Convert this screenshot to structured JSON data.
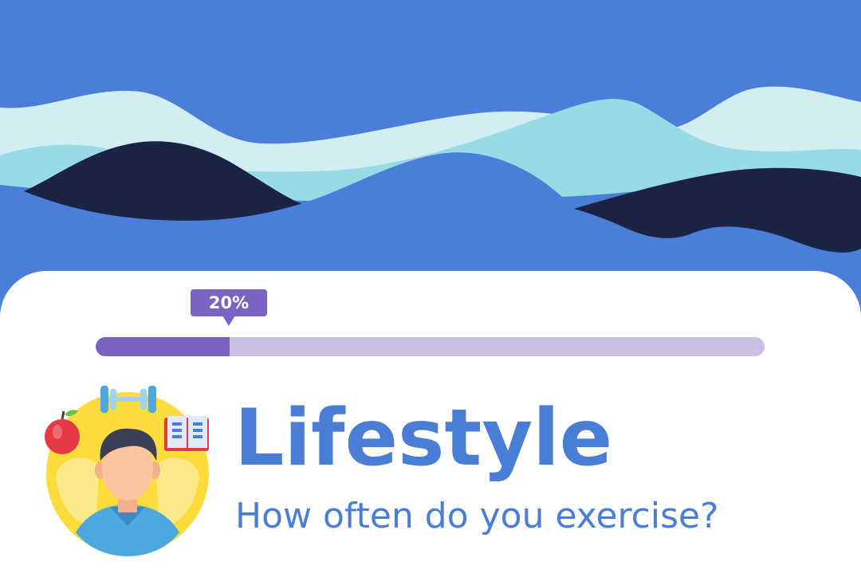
{
  "progress": {
    "label": "20%",
    "value": 0.2
  },
  "section": {
    "title": "Lifestyle",
    "question": "How often do you exercise?"
  },
  "illustration": {
    "icon": "lifestyle-person-icon",
    "items": [
      "apple-icon",
      "dumbbell-icon",
      "book-icon"
    ]
  },
  "colors": {
    "header_blue": "#4a7ed8",
    "wave_light": "#d3eef3",
    "wave_mid": "#97dbe5",
    "wave_dark": "#1a2343",
    "accent_purple": "#7b63c1",
    "track_purple": "#cbbfe6",
    "text_blue": "#4a7dd6"
  }
}
